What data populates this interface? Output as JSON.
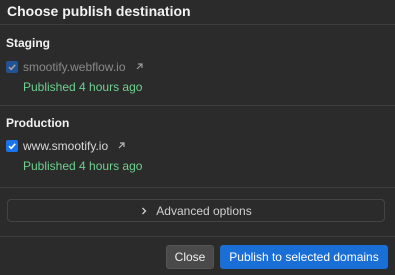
{
  "dialog": {
    "title": "Choose publish destination"
  },
  "staging": {
    "heading": "Staging",
    "domain": "smootify.webflow.io",
    "checked": true,
    "status": "Published 4 hours ago"
  },
  "production": {
    "heading": "Production",
    "domain": "www.smootify.io",
    "checked": true,
    "status": "Published 4 hours ago"
  },
  "advanced": {
    "label": "Advanced options"
  },
  "buttons": {
    "close": "Close",
    "publish": "Publish to selected domains"
  },
  "colors": {
    "accent": "#1a73e8",
    "status_green": "#6fd08f",
    "background": "#2b2b2b"
  },
  "icons": [
    "checkmark-icon",
    "external-link-icon",
    "chevron-right-icon"
  ]
}
